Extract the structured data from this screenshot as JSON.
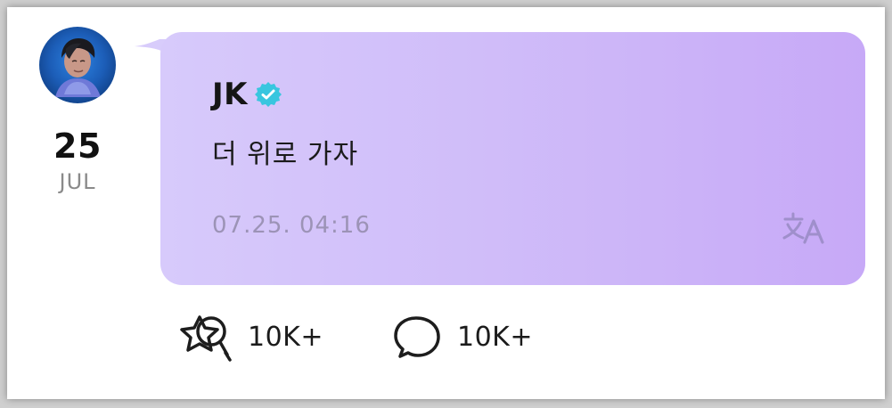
{
  "post": {
    "date": {
      "day": "25",
      "month": "JUL"
    },
    "author": {
      "name": "JK",
      "verified_icon": "verified-check-icon"
    },
    "message": "더 위로 가자",
    "timestamp": "07.25. 04:16",
    "translate_icon": "translate-icon"
  },
  "actions": {
    "reaction_count": "10K+",
    "comment_count": "10K+",
    "reaction_icon": "star-reaction-icon",
    "comment_icon": "comment-icon"
  },
  "colors": {
    "bubble_start": "#d7cafb",
    "bubble_end": "#c7a9f7",
    "verified": "#38c6df",
    "timestamp": "#9c93b6",
    "month": "#8a8a8a"
  }
}
